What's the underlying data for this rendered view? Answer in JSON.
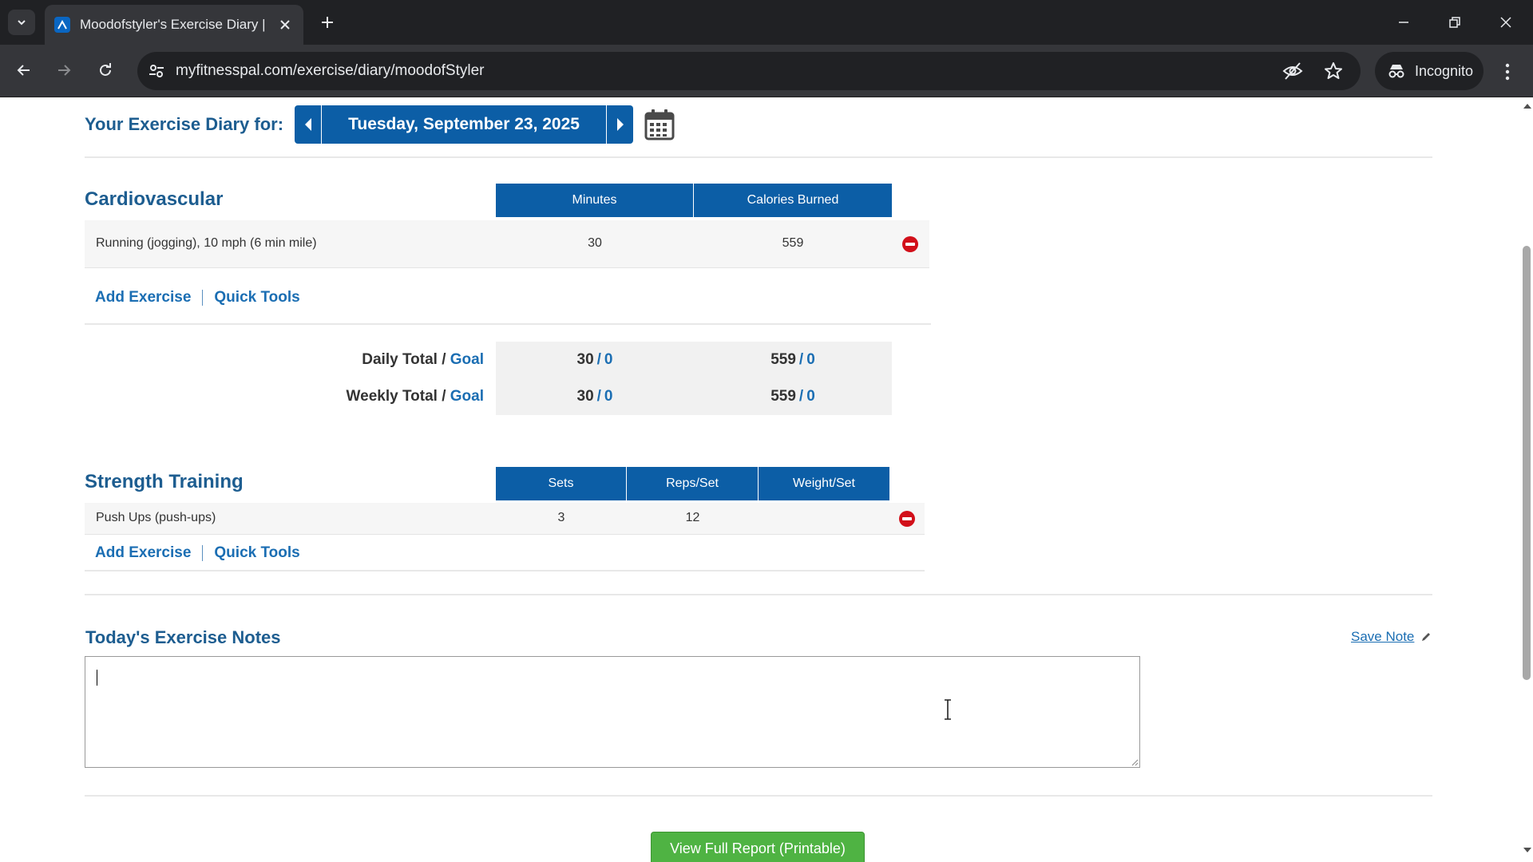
{
  "browser": {
    "tab_title": "Moodofstyler's Exercise Diary |",
    "url": "myfitnesspal.com/exercise/diary/moodofStyler",
    "incognito_label": "Incognito"
  },
  "diary": {
    "header_label": "Your Exercise Diary for:",
    "date": "Tuesday, September 23, 2025"
  },
  "cardio": {
    "title": "Cardiovascular",
    "columns": [
      "Minutes",
      "Calories Burned"
    ],
    "rows": [
      {
        "name": "Running (jogging), 10 mph (6 min mile)",
        "minutes": "30",
        "calories": "559"
      }
    ],
    "add_exercise": "Add Exercise",
    "quick_tools": "Quick Tools"
  },
  "totals": {
    "daily_label": "Daily Total",
    "weekly_label": "Weekly Total",
    "goal_label": "Goal",
    "slash": "/",
    "daily_minutes": "30",
    "daily_minutes_goal": "0",
    "daily_calories": "559",
    "daily_calories_goal": "0",
    "weekly_minutes": "30",
    "weekly_minutes_goal": "0",
    "weekly_calories": "559",
    "weekly_calories_goal": "0"
  },
  "strength": {
    "title": "Strength Training",
    "columns": [
      "Sets",
      "Reps/Set",
      "Weight/Set"
    ],
    "rows": [
      {
        "name": "Push Ups (push-ups)",
        "sets": "3",
        "reps": "12",
        "weight": ""
      }
    ],
    "add_exercise": "Add Exercise",
    "quick_tools": "Quick Tools"
  },
  "notes": {
    "title": "Today's Exercise Notes",
    "save_label": "Save Note",
    "value": ""
  },
  "report": {
    "button_label": "View Full Report (Printable)"
  },
  "colors": {
    "brand_blue": "#0c5ea6",
    "heading_blue": "#1d5d90",
    "link_blue": "#1b6eb3",
    "remove_red": "#d2101a",
    "report_green": "#4fb343"
  }
}
